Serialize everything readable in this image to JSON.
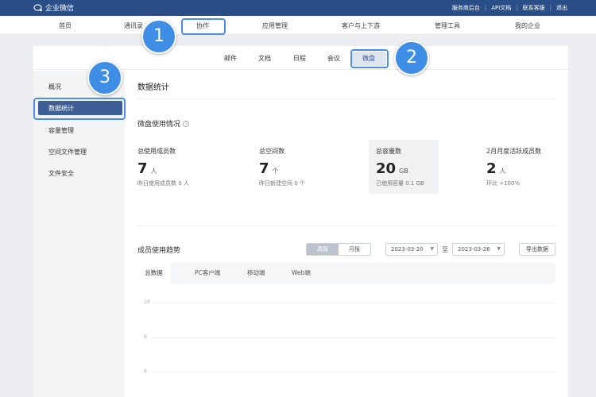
{
  "app": {
    "title": "企业微信"
  },
  "top_links": [
    "服务商后台",
    "API文档",
    "联系客服",
    "退出"
  ],
  "main_nav": [
    "首页",
    "通讯录",
    "协作",
    "应用管理",
    "客户与上下游",
    "管理工具",
    "我的企业"
  ],
  "sub_nav": [
    "邮件",
    "文档",
    "日程",
    "会议",
    "微盘"
  ],
  "sidebar": [
    "概况",
    "数据统计",
    "容量管理",
    "空间文件管理",
    "文件安全"
  ],
  "page_title": "数据统计",
  "section_title": "微盘使用情况",
  "stats": [
    {
      "label": "总使用成员数",
      "value": "7",
      "unit": "人",
      "sub": "昨日使用成员数 0 人"
    },
    {
      "label": "总空间数",
      "value": "7",
      "unit": "个",
      "sub": "昨日新建空间 0 个"
    },
    {
      "label": "总容量数",
      "value": "20",
      "unit": "GB",
      "sub": "已使用容量 0.1 GB"
    },
    {
      "label": "2月月度活跃成员数",
      "value": "2",
      "unit": "人",
      "sub": "环比 +100%"
    }
  ],
  "trend": {
    "title": "成员使用趋势",
    "toggle": [
      "周报",
      "月报"
    ],
    "date_from": "2023-03-20",
    "to_label": "至",
    "date_to": "2023-03-26",
    "export_label": "导出数据",
    "tabs": [
      "总数据",
      "PC客户端",
      "移动端",
      "Web端"
    ],
    "y_ticks": [
      "10",
      "8",
      "6"
    ]
  },
  "annotations": [
    "1",
    "2",
    "3"
  ],
  "colors": {
    "topbar": "#2a4f88",
    "accent": "#3f8ee6",
    "sidebar_active": "#3e5f96"
  }
}
